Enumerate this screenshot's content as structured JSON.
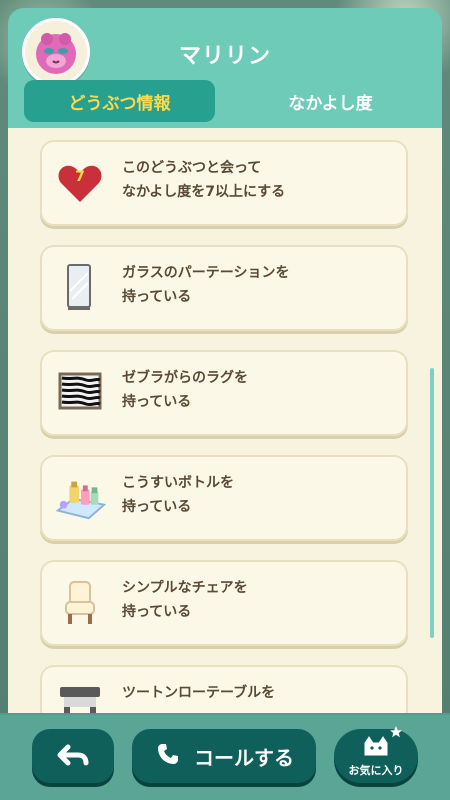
{
  "colors": {
    "teal": "#6ecbb8",
    "tab_active_bg": "#27a08f",
    "tab_active_text": "#ffd94a",
    "content_bg": "#f7f3de",
    "button_dark": "#0f5f5a"
  },
  "header": {
    "title": "マリリン",
    "avatar_icon": "villager-avatar-icon"
  },
  "tabs": [
    {
      "label": "どうぶつ情報",
      "active": true
    },
    {
      "label": "なかよし度",
      "active": false
    }
  ],
  "list": [
    {
      "icon": "heart-icon",
      "badge": "7",
      "text": "このどうぶつと会って\nなかよし度を7以上にする"
    },
    {
      "icon": "glass-partition-icon",
      "text": "ガラスのパーテーションを\n持っている"
    },
    {
      "icon": "zebra-rug-icon",
      "text": "ゼブラがらのラグを\n持っている"
    },
    {
      "icon": "perfume-bottles-icon",
      "text": "こうすいボトルを\n持っている"
    },
    {
      "icon": "chair-icon",
      "text": "シンプルなチェアを\n持っている"
    },
    {
      "icon": "low-table-icon",
      "text": "ツートンローテーブルを"
    }
  ],
  "bottom": {
    "back_icon": "back-arrow-icon",
    "call_label": "コールする",
    "call_icon": "phone-icon",
    "favorite_label": "お気に入り",
    "favorite_icon": "cat-star-icon"
  }
}
